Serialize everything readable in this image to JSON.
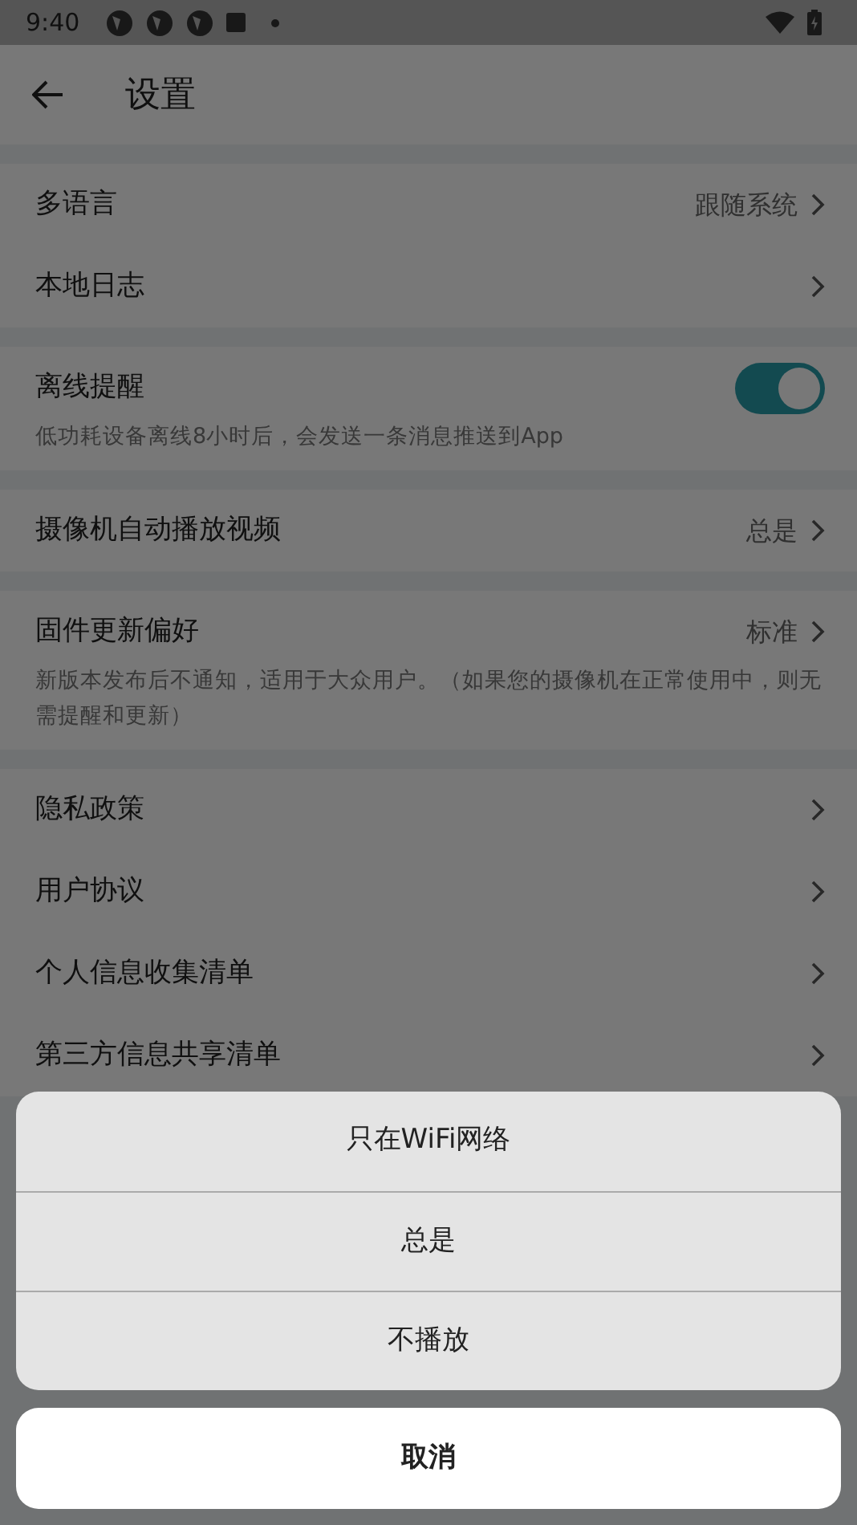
{
  "status_bar": {
    "time": "9:40"
  },
  "header": {
    "title": "设置"
  },
  "sections": [
    {
      "items": [
        {
          "kind": "link",
          "label": "多语言",
          "value": "跟随系统"
        },
        {
          "kind": "link",
          "label": "本地日志"
        }
      ]
    },
    {
      "items": [
        {
          "kind": "toggle",
          "label": "离线提醒",
          "on": true,
          "description": "低功耗设备离线8小时后，会发送一条消息推送到App"
        }
      ]
    },
    {
      "items": [
        {
          "kind": "link",
          "label": "摄像机自动播放视频",
          "value": "总是"
        }
      ]
    },
    {
      "items": [
        {
          "kind": "link",
          "label": "固件更新偏好",
          "value": "标准",
          "description": "新版本发布后不通知，适用于大众用户。（如果您的摄像机在正常使用中，则无需提醒和更新）"
        }
      ]
    },
    {
      "items": [
        {
          "kind": "link",
          "label": "隐私政策"
        },
        {
          "kind": "link",
          "label": "用户协议"
        },
        {
          "kind": "link",
          "label": "个人信息收集清单"
        },
        {
          "kind": "link",
          "label": "第三方信息共享清单"
        }
      ]
    }
  ],
  "action_sheet": {
    "options": [
      "只在WiFi网络",
      "总是",
      "不播放"
    ],
    "cancel": "取消"
  }
}
